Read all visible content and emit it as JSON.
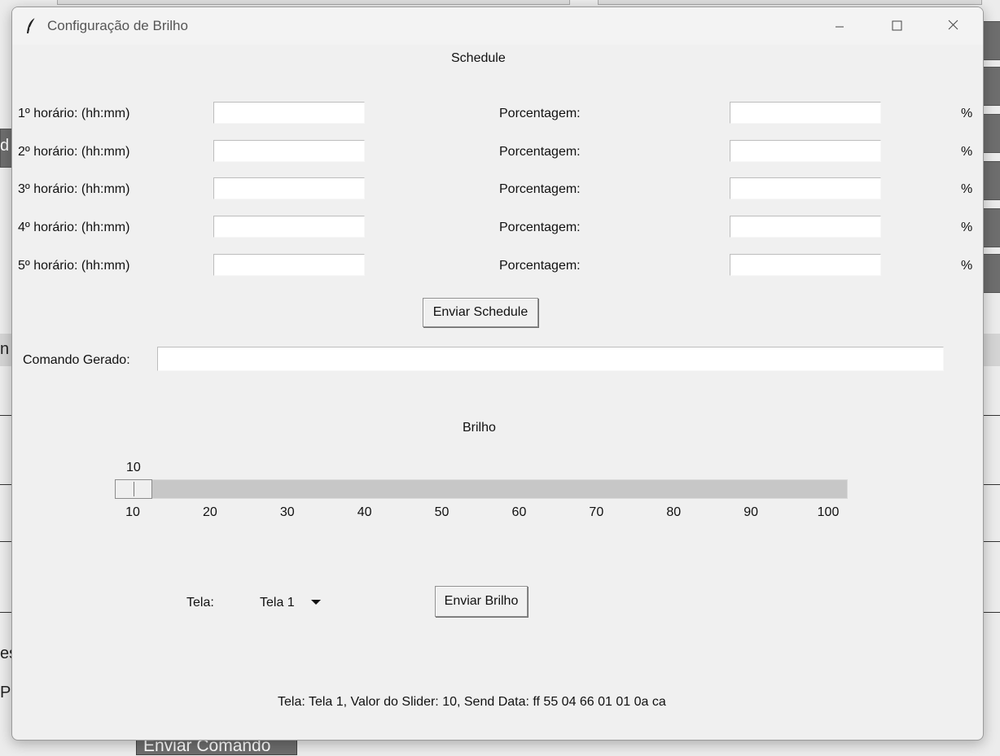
{
  "window": {
    "title": "Configuração de Brilho"
  },
  "schedule": {
    "heading": "Schedule",
    "rows": [
      {
        "time_label": "1º horário: (hh:mm)",
        "time_value": "",
        "pct_label": "Porcentagem:",
        "pct_value": "",
        "unit": "%"
      },
      {
        "time_label": "2º horário: (hh:mm)",
        "time_value": "",
        "pct_label": "Porcentagem:",
        "pct_value": "",
        "unit": "%"
      },
      {
        "time_label": "3º horário: (hh:mm)",
        "time_value": "",
        "pct_label": "Porcentagem:",
        "pct_value": "",
        "unit": "%"
      },
      {
        "time_label": "4º horário: (hh:mm)",
        "time_value": "",
        "pct_label": "Porcentagem:",
        "pct_value": "",
        "unit": "%"
      },
      {
        "time_label": "5º horário: (hh:mm)",
        "time_value": "",
        "pct_label": "Porcentagem:",
        "pct_value": "",
        "unit": "%"
      }
    ],
    "send_label": "Enviar Schedule"
  },
  "command": {
    "label": "Comando Gerado:",
    "value": ""
  },
  "brightness": {
    "heading": "Brilho",
    "value": 10,
    "value_label": "10",
    "min": 10,
    "max": 100,
    "ticks": [
      "10",
      "20",
      "30",
      "40",
      "50",
      "60",
      "70",
      "80",
      "90",
      "100"
    ]
  },
  "screen": {
    "label": "Tela:",
    "selected": "Tela 1",
    "send_label": "Enviar Brilho"
  },
  "status": {
    "text": "Tela: Tela 1, Valor do Slider: 10, Send Data: ff 55 04 66 01 01 0a ca"
  },
  "background_app": {
    "send_command_label": "Enviar Comando",
    "fragment_left_1": "d",
    "fragment_left_2": "n",
    "fragment_left_3": "es",
    "fragment_left_4": "Po"
  }
}
